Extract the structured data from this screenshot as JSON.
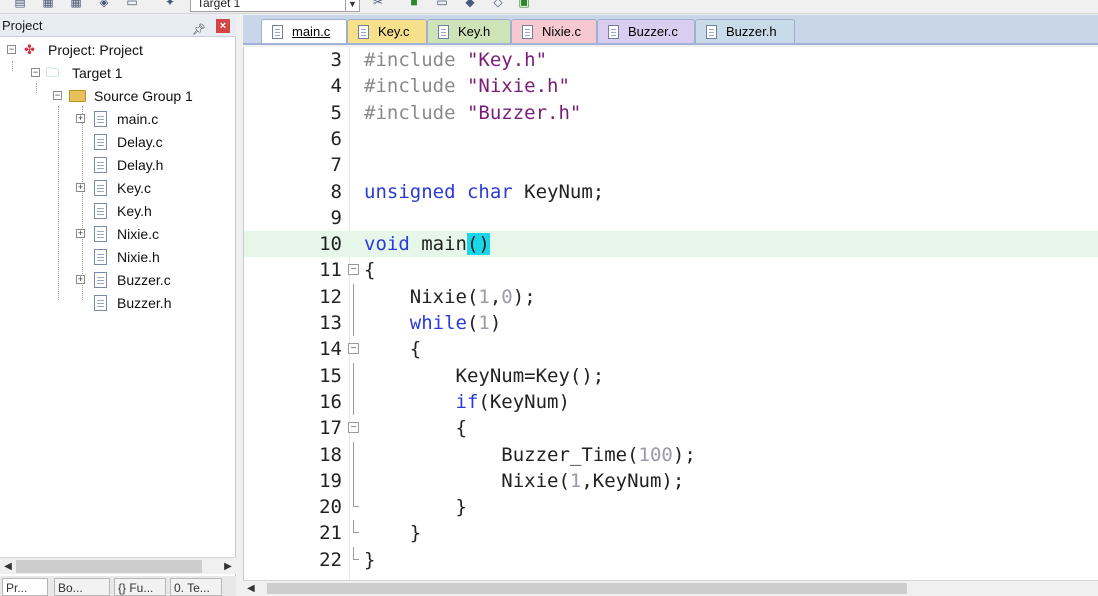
{
  "toolbar": {
    "target_select": "Target 1"
  },
  "project_panel": {
    "title": "Project",
    "pin_icon": "pin-icon",
    "close_label": "×",
    "tree": {
      "project": "Project: Project",
      "target": "Target 1",
      "group": "Source Group 1",
      "files": [
        {
          "name": "main.c",
          "expandable": true
        },
        {
          "name": "Delay.c",
          "expandable": false
        },
        {
          "name": "Delay.h",
          "expandable": false
        },
        {
          "name": "Key.c",
          "expandable": true
        },
        {
          "name": "Key.h",
          "expandable": false
        },
        {
          "name": "Nixie.c",
          "expandable": true
        },
        {
          "name": "Nixie.h",
          "expandable": false
        },
        {
          "name": "Buzzer.c",
          "expandable": true
        },
        {
          "name": "Buzzer.h",
          "expandable": false
        }
      ]
    },
    "bottom_tabs": [
      "Pr...",
      "Bo...",
      "{} Fu...",
      "0. Te..."
    ]
  },
  "editor_tabs": [
    {
      "label": "main.c",
      "color": "#c9d6ea",
      "active": true
    },
    {
      "label": "Key.c",
      "color": "#f6e08c",
      "active": false
    },
    {
      "label": "Key.h",
      "color": "#cfe3b8",
      "active": false
    },
    {
      "label": "Nixie.c",
      "color": "#f5c9cf",
      "active": false
    },
    {
      "label": "Buzzer.c",
      "color": "#d9cdf0",
      "active": false
    },
    {
      "label": "Buzzer.h",
      "color": "#c9dbe8",
      "active": false
    }
  ],
  "code_lines": [
    {
      "n": "3",
      "text": "#include \"Key.h\""
    },
    {
      "n": "4",
      "text": "#include \"Nixie.h\""
    },
    {
      "n": "5",
      "text": "#include \"Buzzer.h\""
    },
    {
      "n": "6",
      "text": ""
    },
    {
      "n": "7",
      "text": ""
    },
    {
      "n": "8",
      "text": "unsigned char KeyNum;"
    },
    {
      "n": "9",
      "text": ""
    },
    {
      "n": "10",
      "text": "void main()"
    },
    {
      "n": "11",
      "text": "{"
    },
    {
      "n": "12",
      "text": "    Nixie(1,0);"
    },
    {
      "n": "13",
      "text": "    while(1)"
    },
    {
      "n": "14",
      "text": "    {"
    },
    {
      "n": "15",
      "text": "        KeyNum=Key();"
    },
    {
      "n": "16",
      "text": "        if(KeyNum)"
    },
    {
      "n": "17",
      "text": "        {"
    },
    {
      "n": "18",
      "text": "            Buzzer_Time(100);"
    },
    {
      "n": "19",
      "text": "            Nixie(1,KeyNum);"
    },
    {
      "n": "20",
      "text": "        }"
    },
    {
      "n": "21",
      "text": "    }"
    },
    {
      "n": "22",
      "text": "}"
    }
  ]
}
